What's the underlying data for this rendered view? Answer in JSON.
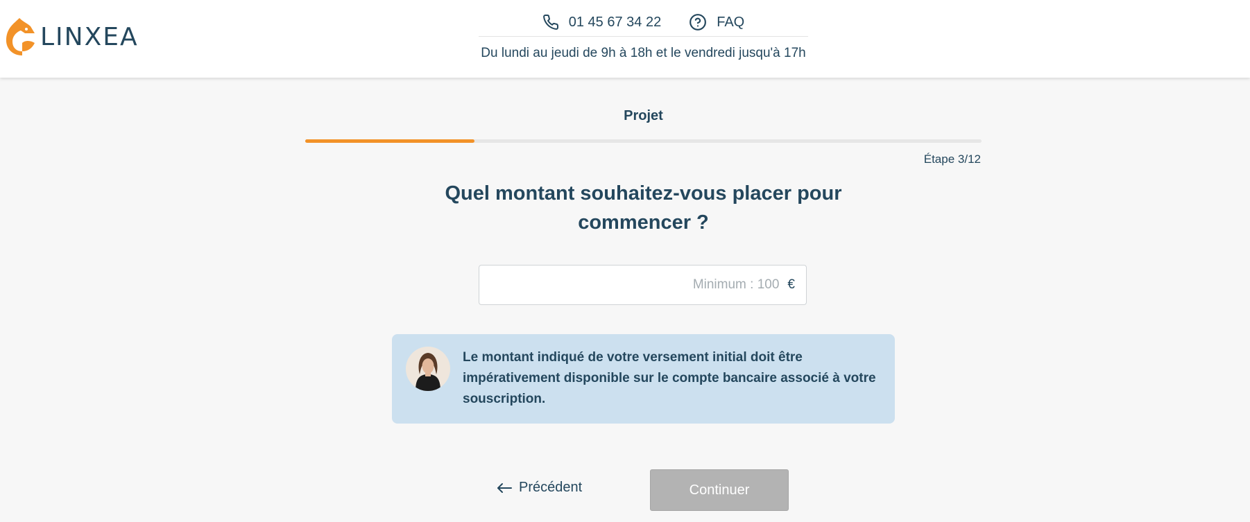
{
  "brand": {
    "name": "LINXEA",
    "accent": "#f29228",
    "text_color": "#24475d"
  },
  "header": {
    "phone_icon": "phone-icon",
    "phone": "01 45 67 34 22",
    "faq_icon": "help-circle-icon",
    "faq_label": "FAQ",
    "hours": "Du lundi au jeudi de 9h à 18h et le vendredi jusqu'à 17h"
  },
  "progress": {
    "section_title": "Projet",
    "step_label": "Étape 3/12",
    "fill_fraction": 0.25
  },
  "question": {
    "title": "Quel montant souhaitez-vous placer pour commencer ?"
  },
  "amount_field": {
    "value": "",
    "placeholder": "Minimum : 100",
    "currency": "€"
  },
  "info_box": {
    "background": "#cce0ef",
    "text": "Le montant indiqué de votre versement initial doit être impérativement disponible sur le compte bancaire associé à votre souscription."
  },
  "navigation": {
    "back_icon": "arrow-left-icon",
    "back_label": "Précédent",
    "continue_label": "Continuer",
    "continue_disabled": true
  }
}
